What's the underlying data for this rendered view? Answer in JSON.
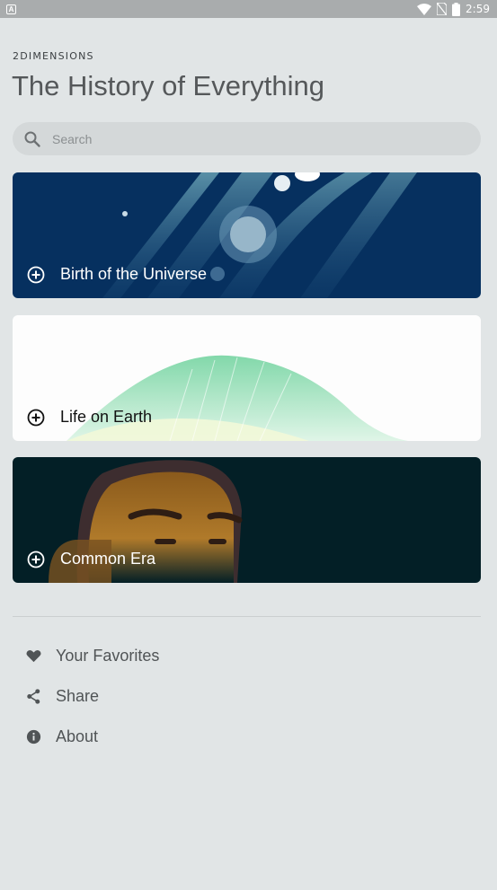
{
  "status_bar": {
    "time": "2:59",
    "notification": "A"
  },
  "header": {
    "brand": "2DIMENSIONS",
    "title": "The History of Everything"
  },
  "search": {
    "placeholder": "Search",
    "icon": "search-icon"
  },
  "eras": [
    {
      "label": "Birth of the Universe",
      "color": "#06305f"
    },
    {
      "label": "Life on Earth",
      "color": "#fdfdfd"
    },
    {
      "label": "Common Era",
      "color": "#031f26"
    }
  ],
  "menu": [
    {
      "label": "Your Favorites",
      "icon": "heart-icon"
    },
    {
      "label": "Share",
      "icon": "share-icon"
    },
    {
      "label": "About",
      "icon": "info-icon"
    }
  ]
}
